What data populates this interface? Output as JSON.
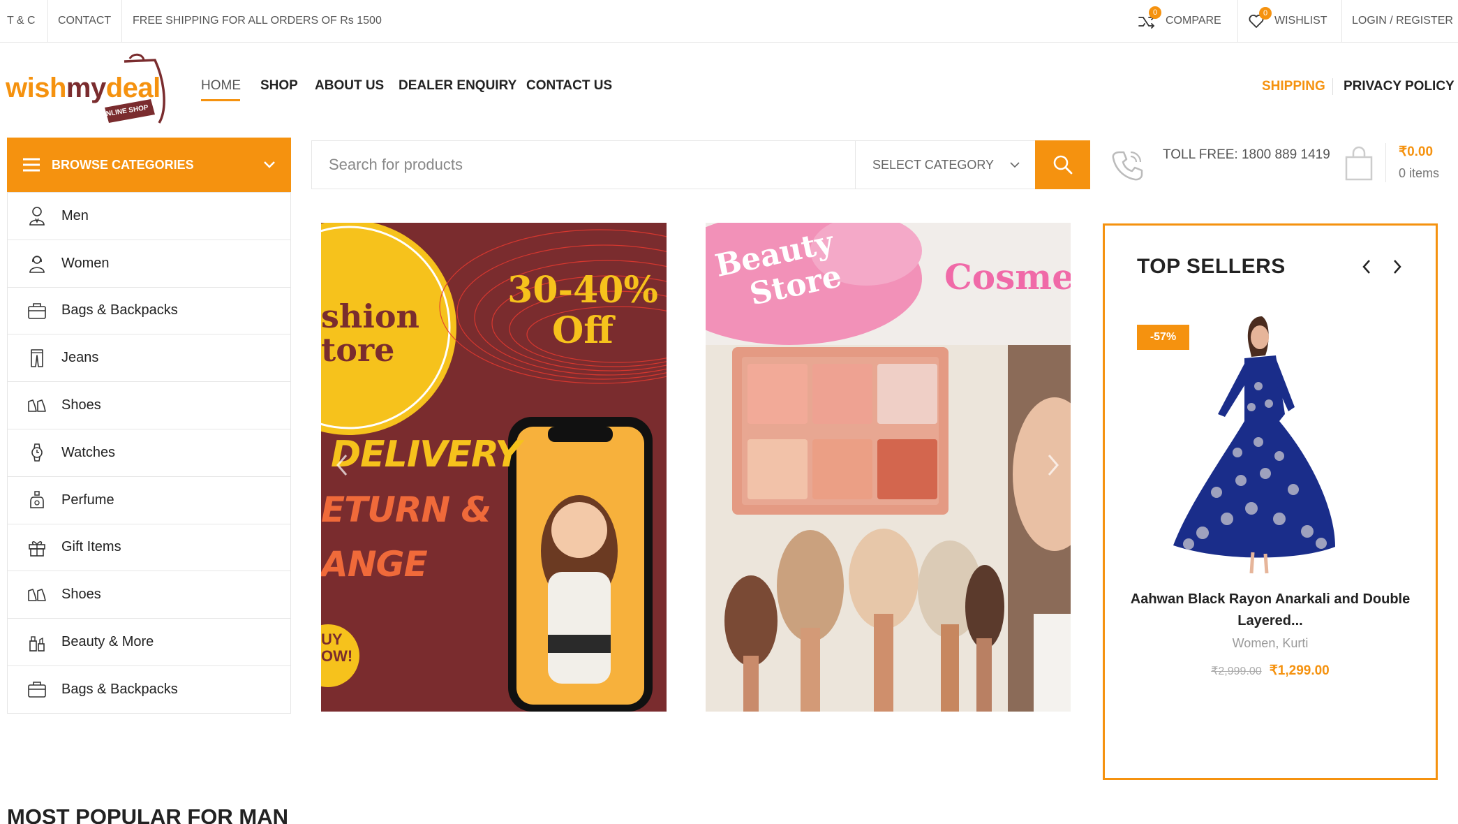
{
  "topbar": {
    "tc": "T & C",
    "contact": "CONTACT",
    "shipping_note": "FREE SHIPPING FOR ALL ORDERS OF Rs 1500",
    "compare": "COMPARE",
    "compare_count": "0",
    "wishlist": "WISHLIST",
    "wishlist_count": "0",
    "login": "LOGIN / REGISTER"
  },
  "logo": {
    "text_wish": "wish",
    "text_my": "my",
    "text_deal": "deal",
    "tag": "ONLINE SHOP"
  },
  "nav": {
    "home": "HOME",
    "shop": "SHOP",
    "about": "ABOUT US",
    "dealer": "DEALER ENQUIRY",
    "contact": "CONTACT US",
    "shipping": "SHIPPING",
    "privacy": "PRIVACY POLICY"
  },
  "categories": {
    "header": "BROWSE CATEGORIES",
    "items": [
      {
        "label": "Men",
        "icon": "man-icon"
      },
      {
        "label": "Women",
        "icon": "woman-icon"
      },
      {
        "label": "Bags & Backpacks",
        "icon": "bag-icon"
      },
      {
        "label": "Jeans",
        "icon": "jeans-icon"
      },
      {
        "label": "Shoes",
        "icon": "shoes-icon"
      },
      {
        "label": "Watches",
        "icon": "watch-icon"
      },
      {
        "label": "Perfume",
        "icon": "perfume-icon"
      },
      {
        "label": "Gift Items",
        "icon": "gift-icon"
      },
      {
        "label": "Shoes",
        "icon": "shoes-icon"
      },
      {
        "label": "Beauty & More",
        "icon": "beauty-icon"
      },
      {
        "label": "Bags & Backpacks",
        "icon": "bag-icon"
      }
    ]
  },
  "search": {
    "placeholder": "Search for products",
    "category": "SELECT CATEGORY"
  },
  "contact": {
    "toll_free": "TOLL FREE: 1800 889 1419"
  },
  "cart": {
    "total": "₹0.00",
    "items": "0 items"
  },
  "banner1": {
    "brand_line1": "shion",
    "brand_line2": "tore",
    "offer_line1": "30-40%",
    "offer_line2": "Off",
    "line1": "DELIVERY",
    "line2": "ETURN &",
    "line3": "ANGE",
    "badge_line1": "UY",
    "badge_line2": "OW!"
  },
  "banner2": {
    "line1": "Beauty",
    "line2": "Store",
    "word": "Cosmet"
  },
  "top_sellers": {
    "title": "TOP SELLERS",
    "discount": "-57%",
    "product_name": "Aahwan Black Rayon Anarkali and Double Layered...",
    "product_categories": "Women, Kurti",
    "old_price": "₹2,999.00",
    "new_price": "₹1,299.00"
  },
  "section": {
    "title": "MOST POPULAR FOR MAN"
  },
  "colors": {
    "accent": "#f5920f",
    "logo_brown": "#7a2c2e"
  }
}
